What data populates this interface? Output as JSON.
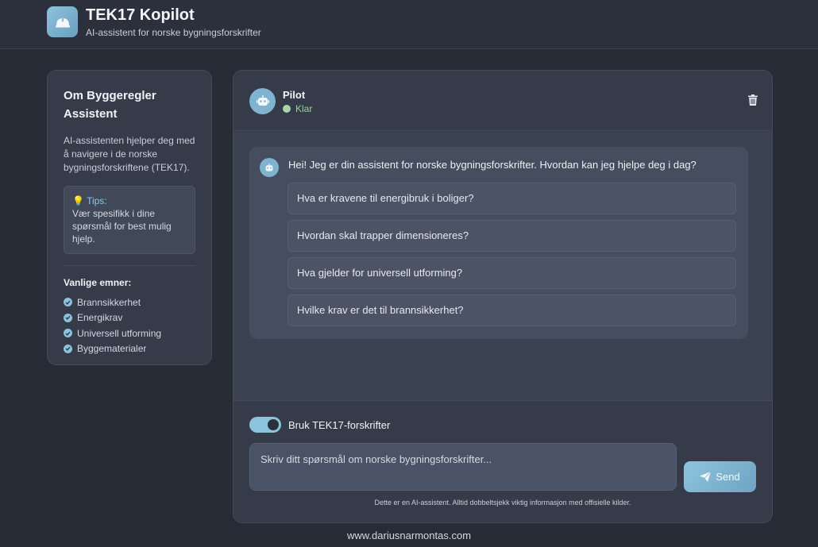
{
  "header": {
    "title": "TEK17 Kopilot",
    "subtitle": "AI-assistent for norske bygningsforskrifter",
    "logo_icon": "hardhat-icon"
  },
  "sidebar": {
    "title": "Om Byggeregler Assistent",
    "description": "AI-assistenten hjelper deg med å navigere i de norske bygningsforskriftene (TEK17).",
    "tips_label": "Tips:",
    "tips_icon": "lightbulb-icon",
    "tips_text": "Vær spesifikk i dine spørsmål for best mulig hjelp.",
    "topics_title": "Vanlige emner:",
    "topics": [
      {
        "label": "Brannsikkerhet"
      },
      {
        "label": "Energikrav"
      },
      {
        "label": "Universell utforming"
      },
      {
        "label": "Byggematerialer"
      }
    ]
  },
  "chat": {
    "bot_name": "Pilot",
    "status": "Klar",
    "status_color": "#a5d6a7",
    "greeting": "Hei! Jeg er din assistent for norske bygningsforskrifter. Hvordan kan jeg hjelpe deg i dag?",
    "suggestions": [
      {
        "label": "Hva er kravene til energibruk i boliger?"
      },
      {
        "label": "Hvordan skal trapper dimensioneres?"
      },
      {
        "label": "Hva gjelder for universell utforming?"
      },
      {
        "label": "Hvilke krav er det til brannsikkerhet?"
      }
    ]
  },
  "composer": {
    "toggle_label": "Bruk TEK17-forskrifter",
    "toggle_on": true,
    "placeholder": "Skriv ditt spørsmål om norske bygningsforskrifter...",
    "send_label": "Send",
    "disclaimer": "Dette er en AI-assistent. Alltid dobbeltsjekk viktig informasjon med offisielle kilder."
  },
  "footer": {
    "text": "www.dariusnarmontas.com"
  },
  "colors": {
    "accent": "#8cc3dc",
    "background": "#262b36",
    "panel": "#353b49"
  }
}
